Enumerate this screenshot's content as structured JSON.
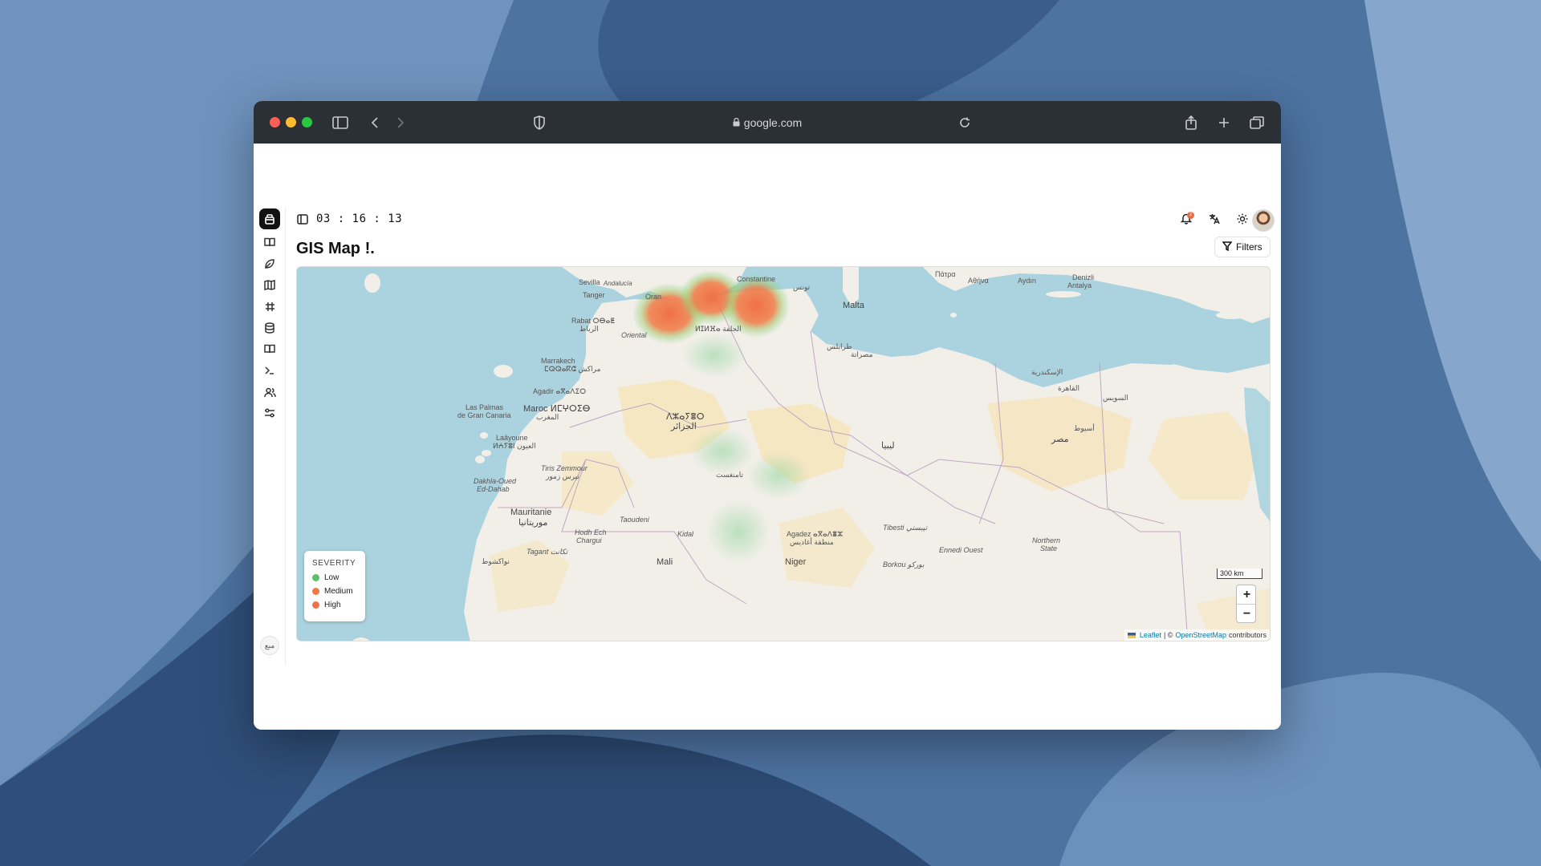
{
  "browser": {
    "url": "google.com"
  },
  "app": {
    "clock": "03 : 16 : 13",
    "page_title": "GIS Map !.",
    "filters_label": "Filters",
    "notification_count": "2",
    "rail_footer_label": "مبع",
    "nav_icons": [
      "book-icon",
      "leaf-icon",
      "map-icon",
      "hash-icon",
      "database-icon",
      "book-open-icon",
      "terminal-icon",
      "users-icon",
      "sliders-icon"
    ]
  },
  "map": {
    "legend": {
      "title": "SEVERITY",
      "items": [
        {
          "label": "Low",
          "color": "#5cbf6a"
        },
        {
          "label": "Medium",
          "color": "#ef7a45"
        },
        {
          "label": "High",
          "color": "#e9744c"
        }
      ]
    },
    "scale_label": "300 km",
    "zoom_in": "+",
    "zoom_out": "−",
    "attribution": {
      "leaflet": "Leaflet",
      "separator": "| ©",
      "osm": "OpenStreetMap",
      "contributors": "contributors"
    },
    "places": {
      "sevilla": "Sevilla",
      "andalucia": "Andalucía",
      "tanger": "Tanger",
      "oran": "Oran",
      "constantine": "Constantine",
      "tunis": "تونس",
      "malta": "Malta",
      "patra": "Πάτρα",
      "athina": "Αθήνα",
      "aydin": "Aydın",
      "denizli": "Denizli",
      "antalya": "Antalya",
      "rabat": "Rabat ⵔⴱⴰⵟ",
      "rabat_ar": "الرباط",
      "oriental": "Oriental",
      "djelfa": "ⵍⵊⵍⴼⴰ الجلفة",
      "marrakech": "Marrakech",
      "marrakech_ar": "ⵎⵕⵕⴰⴽⵛ مراكش",
      "agadir": "Agadir ⴰⴳⴰⴷⵉⵔ",
      "las_palmas": "Las Palmas",
      "gran_canaria": "de Gran Canaria",
      "maroc": "Maroc ⵍⵎⵖⵔⵉⴱ",
      "maroc_ar": "المغرب",
      "laayoune": "Laâyoune",
      "laayoune_ar": "ⵍⵄⵢⵓⵏ العيون",
      "algerie": "ⴷⵣⴰⵢⴻⵔ",
      "algerie_ar": "الجزائر",
      "libya": "ليبيا",
      "misrata": "مصراتة",
      "tripoli": "طرابلس",
      "alexandria": "الإسكندرية",
      "cairo": "القاهرة",
      "suez": "السويس",
      "asyut": "أسيوط",
      "misr": "مصر",
      "mauritanie": "Mauritanie",
      "mauritanie_ar": "موريتانيا",
      "tiris": "Tiris Zemmour",
      "tiris_ar": "تيرس زمور",
      "dakhla": "Dakhla-Oued",
      "dakhla2": "Ed-Dahab",
      "nouakchott": "نواكشوط",
      "mali": "Mali",
      "niger": "Niger",
      "agadez": "Agadez ⴰⴳⴰⴷⴻⵣ",
      "agadez_ar": "منطقة أغاديس",
      "tibesti": "Tibesti تيبستي",
      "ennedi": "Ennedi Ouest",
      "borkou": "Borkou بوركو",
      "northern_state": "Northern",
      "northern_state2": "State",
      "taoudeni": "Taoudeni",
      "kidal": "Kidal",
      "tagant": "Tagant تكانت",
      "hodh": "Hodh Ech",
      "hodh2": "Chargui",
      "tamanrasset": "تامنغست",
      "mediterranean": "Malta"
    }
  }
}
